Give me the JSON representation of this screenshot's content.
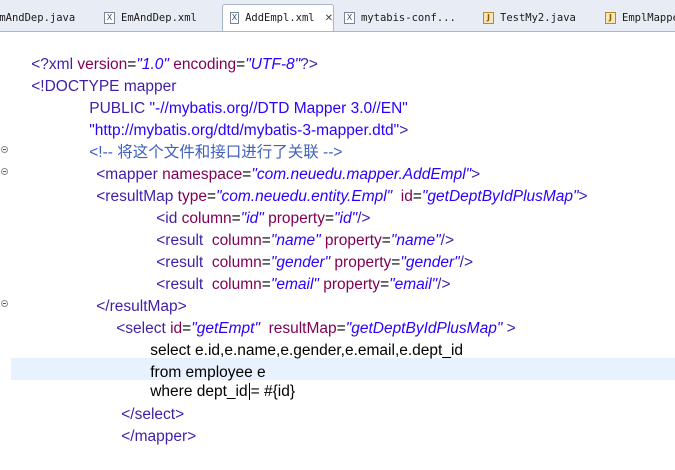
{
  "tabs": [
    {
      "label": "EmAndDep.java",
      "icon": "java-file-icon",
      "active": false
    },
    {
      "label": "EmAndDep.xml",
      "icon": "xml-file-icon",
      "active": false
    },
    {
      "label": "AddEmpl.xml",
      "icon": "xml-file-icon",
      "active": true,
      "close": "✕"
    },
    {
      "label": "mytabis-conf...",
      "icon": "xml-file-icon",
      "active": false
    },
    {
      "label": "TestMy2.java",
      "icon": "java-file-icon",
      "active": false
    },
    {
      "label": "EmplMappe",
      "icon": "java-file-icon",
      "active": false
    }
  ],
  "colors": {
    "tag": "#3f1fa7",
    "attribute": "#7f0055",
    "value": "#2a00ff",
    "comment": "#3f5fbf",
    "current_line": "#e8f2fe"
  },
  "code": {
    "l1_open": "<?xml ",
    "l1_attr1": "version",
    "l1_eq1": "=",
    "l1_val1": "\"1.0\"",
    "l1_attr2": " encoding",
    "l1_eq2": "=",
    "l1_val2": "\"UTF-8\"",
    "l1_close": "?>",
    "l2_text": "<!DOCTYPE mapper",
    "l3_kw": "PUBLIC ",
    "l3_val": "\"-//mybatis.org//DTD Mapper 3.0//EN\"",
    "l4_val": "\"http://mybatis.org/dtd/mybatis-3-mapper.dtd\"",
    "l4_close": ">",
    "l5_comment": "<!-- 将这个文件和接口进行了关联 -->",
    "l6_open": "<mapper ",
    "l6_attr": "namespace",
    "l6_eq": "=",
    "l6_val": "\"com.neuedu.mapper.AddEmpl\"",
    "l6_close": ">",
    "l7_open": "<resultMap ",
    "l7_attr1": "type",
    "l7_eq1": "=",
    "l7_val1": "\"com.neuedu.entity.Empl\"",
    "l7_attr2": "  id",
    "l7_eq2": "=",
    "l7_val2": "\"getDeptByIdPlusMap\"",
    "l7_close": ">",
    "l8_open": "<id ",
    "l8_attr1": "column",
    "l8_eq1": "=",
    "l8_val1": "\"id\"",
    "l8_attr2": " property",
    "l8_eq2": "=",
    "l8_val2": "\"id\"",
    "l8_close": "/>",
    "l9_open": "<result  ",
    "l9_attr1": "column",
    "l9_eq1": "=",
    "l9_val1": "\"name\"",
    "l9_attr2": " property",
    "l9_eq2": "=",
    "l9_val2": "\"name\"",
    "l9_close": "/>",
    "l10_open": "<result  ",
    "l10_attr1": "column",
    "l10_eq1": "=",
    "l10_val1": "\"gender\"",
    "l10_attr2": " property",
    "l10_eq2": "=",
    "l10_val2": "\"gender\"",
    "l10_close": "/>",
    "l11_open": "<result  ",
    "l11_attr1": "column",
    "l11_eq1": "=",
    "l11_val1": "\"email\"",
    "l11_attr2": " property",
    "l11_eq2": "=",
    "l11_val2": "\"email\"",
    "l11_close": "/>",
    "l12_text": "</resultMap>",
    "l13_open": "<select ",
    "l13_attr1": "id",
    "l13_eq1": "=",
    "l13_val1": "\"getEmpt\"",
    "l13_attr2": "  resultMap",
    "l13_eq2": "=",
    "l13_val2": "\"getDeptByIdPlusMap\"",
    "l13_close": " >",
    "l14_text": "select e.id,e.name,e.gender,e.email,e.dept_id",
    "l15_text": "from employee e",
    "l16_text1": "where dept_id",
    "l16_text2": "= #{id}",
    "l17_text": "</select>",
    "l18_text": "</mapper>"
  }
}
